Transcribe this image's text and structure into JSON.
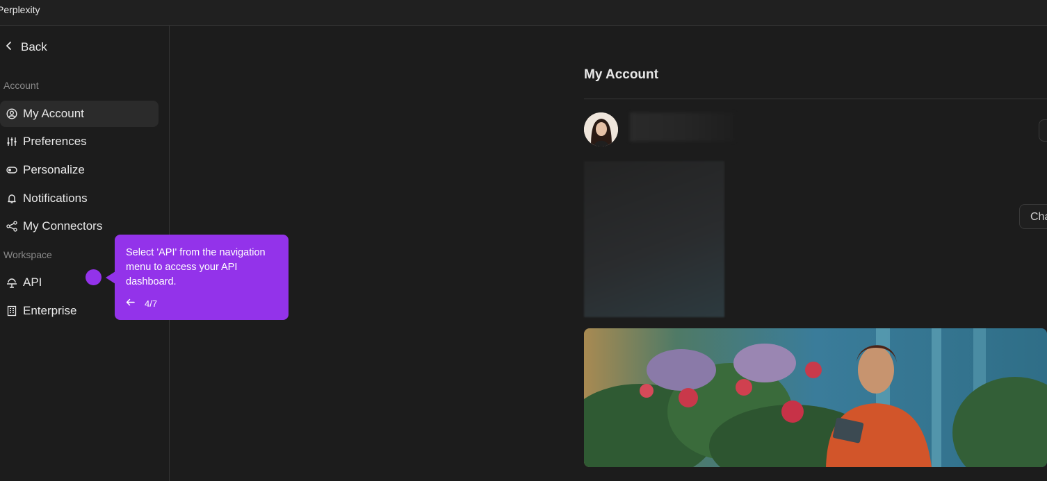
{
  "window": {
    "title": "Perplexity"
  },
  "sidebar": {
    "back_label": "Back",
    "section_account": "Account",
    "section_workspace": "Workspace",
    "items": [
      {
        "label": "My Account",
        "icon": "user-circle-icon"
      },
      {
        "label": "Preferences",
        "icon": "sliders-icon"
      },
      {
        "label": "Personalize",
        "icon": "toggle-icon"
      },
      {
        "label": "Notifications",
        "icon": "bell-icon"
      },
      {
        "label": "My Connectors",
        "icon": "share-nodes-icon"
      },
      {
        "label": "API",
        "icon": "api-icon"
      },
      {
        "label": "Enterprise",
        "icon": "building-icon"
      }
    ]
  },
  "main": {
    "title": "My Account",
    "change_button_label": "Cha"
  },
  "tooltip": {
    "message": "Select 'API' from the navigation menu to access your API dashboard.",
    "step": "4/7",
    "color": "#9333ea"
  }
}
